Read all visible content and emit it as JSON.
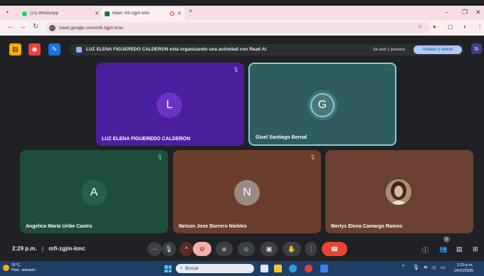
{
  "browser": {
    "tabs": [
      {
        "title": "(21) WhatsApp",
        "favicon_color": "#25d366",
        "active": false
      },
      {
        "title": "Meet: mfi-zgjm-kmc",
        "favicon_color": "#00832d",
        "active": true
      }
    ],
    "url": "meet.google.com/mfi-zgjm-kmc",
    "icons": {
      "tab_menu": "chevron-down-icon",
      "new_tab": "plus-icon",
      "back": "arrow-left-icon",
      "forward": "arrow-right-icon",
      "reload": "reload-icon",
      "bookmark": "star-icon",
      "menu": "kebab-menu-icon"
    }
  },
  "banner": {
    "message": "LUZ ELENA FIGUEREDO CALDERON está organizando una actividad con Read AI",
    "joined": "Se unió 1 persona",
    "install_label": "Instalar y unirse"
  },
  "tiles": [
    {
      "name": "LUZ ELENA FIGUEREDO CALDERON",
      "initial": "L",
      "bg": "#4a1f9e",
      "avatar_bg": "#6a35c2",
      "muted": true
    },
    {
      "name": "Gisel Santiago Bernal",
      "initial": "G",
      "bg": "#2f5c5e",
      "avatar_bg": "#4c7779",
      "speaking": true
    },
    {
      "name": "Angelica Maria Uribe Castro",
      "initial": "A",
      "bg": "#1f4d3b",
      "avatar_bg": "#2a5e49",
      "muted": true
    },
    {
      "name": "Nelson Jose Borrero Niebles",
      "initial": "N",
      "bg": "#6b3d2c",
      "avatar_bg": "#9a8a85",
      "muted": true
    },
    {
      "name": "Merlys Elena Camargo Ramos",
      "initial": "",
      "bg": "#6a4032",
      "avatar_bg": "#c9a98f",
      "photo": true
    }
  ],
  "bottom": {
    "time": "2:29 p.m.",
    "meeting_code": "mfi-zgjm-kmc",
    "participants_count": "5"
  },
  "taskbar": {
    "temperature": "31°C",
    "weather": "Parc. soleado",
    "search_label": "Buscar",
    "time": "2:29 p.m.",
    "date": "14/10/2025"
  }
}
